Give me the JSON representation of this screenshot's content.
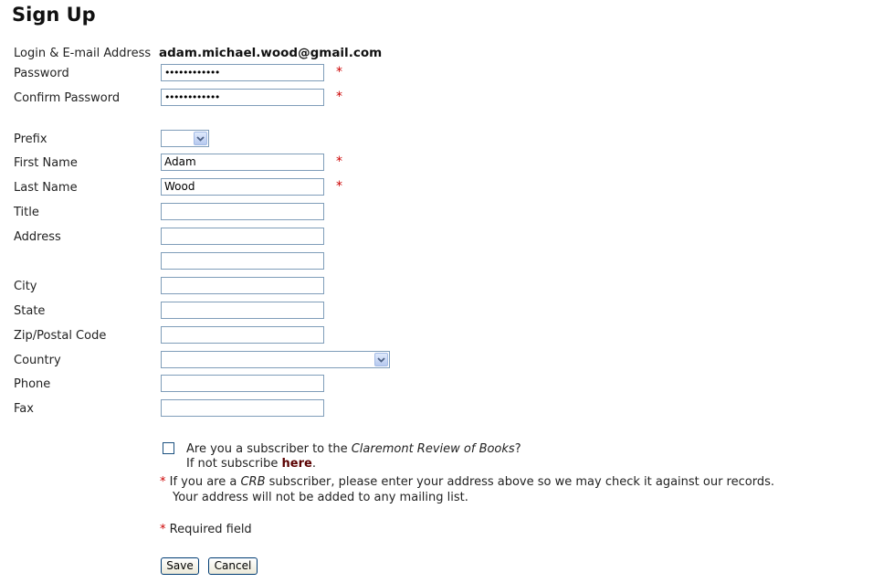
{
  "page": {
    "title": "Sign Up"
  },
  "form": {
    "login": {
      "label": "Login & E-mail Address",
      "value": "adam.michael.wood@gmail.com"
    },
    "password": {
      "label": "Password",
      "masked": "••••••••••••"
    },
    "confirm_password": {
      "label": "Confirm Password",
      "masked": "••••••••••••"
    },
    "prefix": {
      "label": "Prefix",
      "selected": ""
    },
    "first_name": {
      "label": "First Name",
      "value": "Adam"
    },
    "last_name": {
      "label": "Last Name",
      "value": "Wood"
    },
    "title": {
      "label": "Title",
      "value": ""
    },
    "address": {
      "label": "Address",
      "line1": "",
      "line2": ""
    },
    "city": {
      "label": "City",
      "value": ""
    },
    "state": {
      "label": "State",
      "value": ""
    },
    "zip": {
      "label": "Zip/Postal Code",
      "value": ""
    },
    "country": {
      "label": "Country",
      "selected": ""
    },
    "phone": {
      "label": "Phone",
      "value": ""
    },
    "fax": {
      "label": "Fax",
      "value": ""
    },
    "required_marker": "*"
  },
  "subscriber": {
    "question_prefix": "Are you a subscriber to the ",
    "question_title": "Claremont Review of Books",
    "question_suffix": "?",
    "subscribe_prefix": "If not subscribe ",
    "subscribe_link": "here",
    "subscribe_suffix": ".",
    "note_prefix": "If you are a ",
    "note_abbr": "CRB",
    "note_suffix": " subscriber, please enter your address above so we may check it against our records.",
    "note_line2": "Your address will not be added to any mailing list.",
    "required_note": "Required field"
  },
  "buttons": {
    "save": "Save",
    "cancel": "Cancel"
  },
  "colors": {
    "required": "#cc0000",
    "link": "#5a0000",
    "input_border": "#7f9db9"
  }
}
